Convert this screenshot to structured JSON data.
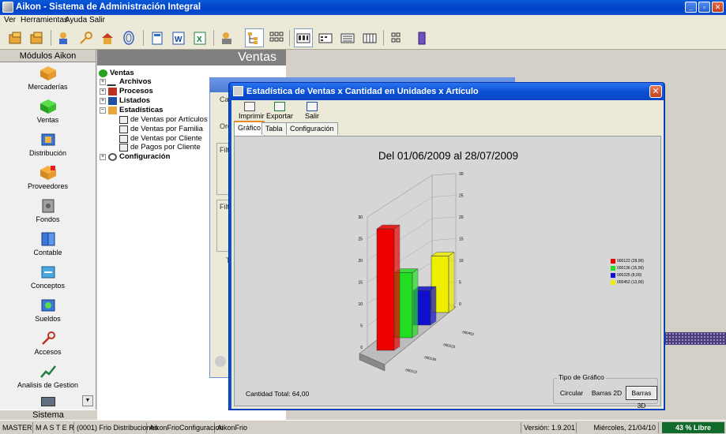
{
  "app": {
    "title": "Aikon - Sistema de Administración Integral"
  },
  "menu": [
    "Ver",
    "Herramientas",
    "Ayuda",
    "Salir"
  ],
  "left": {
    "header": "Módulos Aikon",
    "modules": [
      "Mercaderías",
      "Ventas",
      "Distribución",
      "Proveedores",
      "Fondos",
      "Contable",
      "Conceptos",
      "Sueldos",
      "Accesos",
      "Analisis de Gestion"
    ],
    "footer": "Sistema"
  },
  "tree": {
    "header": "Ventas",
    "root": "Ventas",
    "items": [
      "Archivos",
      "Procesos",
      "Listados",
      "Estadísticas"
    ],
    "sub": [
      "de Ventas por Artículos",
      "de Ventas por Familia",
      "de Ventas por Cliente",
      "de Pagos por Cliente"
    ],
    "config": "Configuración"
  },
  "bgwin": {
    "labels": [
      "Ca",
      "Ord",
      "Filtr",
      "Filtr",
      "T"
    ]
  },
  "window": {
    "title": "Estadística de Ventas x Cantidad en Unidades x Artículo",
    "close": "✕",
    "toolbar": [
      "Imprimir",
      "Exportar",
      "Salir"
    ],
    "tabs": [
      "Gráfico",
      "Tabla",
      "Configuración"
    ],
    "total": "Cantidad Total: 64,00",
    "tipo_label": "Tipo de Gráfico",
    "tipo_buttons": [
      "Circular",
      "Barras 2D",
      "Barras 3D"
    ],
    "tipo_selected": "Barras 3D"
  },
  "chart_data": {
    "type": "bar",
    "title": "Del 01/06/2009 al 28/07/2009",
    "categories": [
      "000122",
      "000136",
      "000225",
      "000452"
    ],
    "series": [
      {
        "values": [
          28,
          15,
          8,
          13
        ]
      }
    ],
    "colors": [
      "#ee0000",
      "#22dd22",
      "#1010cc",
      "#eeee00"
    ],
    "legend": [
      "000122 (28,00)",
      "000136 (15,00)",
      "000225 (8,00)",
      "000452 (13,00)"
    ],
    "yticks": [
      "0",
      "5",
      "10",
      "15",
      "20",
      "25",
      "30"
    ],
    "ylim": [
      0,
      30
    ],
    "legend_position": "right"
  },
  "status": [
    "MASTER",
    "M A S T E R",
    "(0001) Frio Distribuciones",
    "AikonFrioConfiguracion",
    "AikonFrio",
    "Versión: 1.9.201",
    "Miércoles, 21/04/10",
    "43 % Libre"
  ]
}
